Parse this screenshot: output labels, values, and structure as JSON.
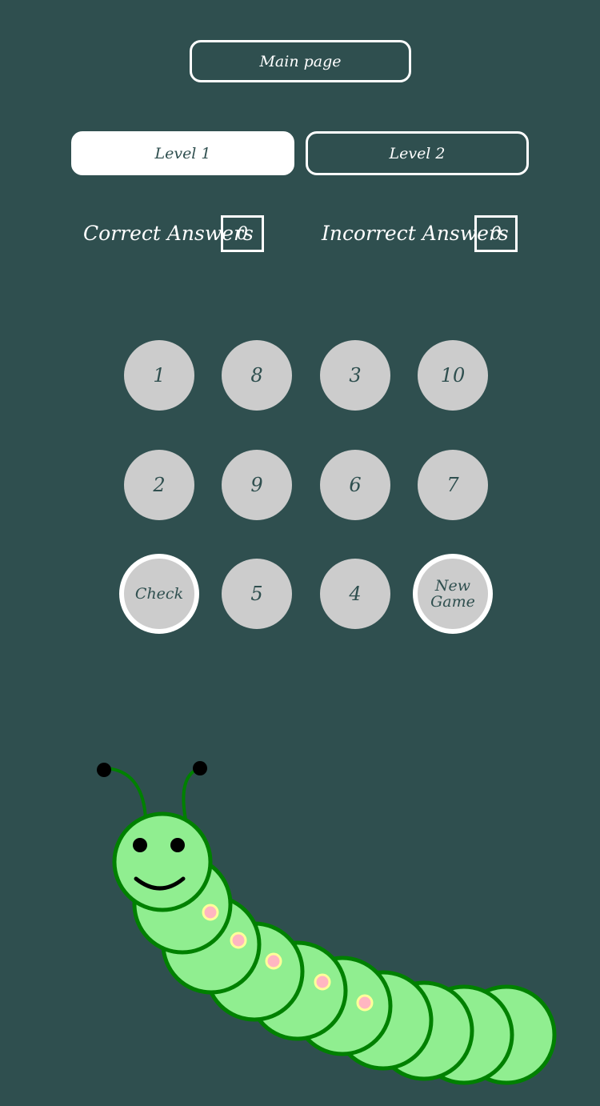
{
  "nav": {
    "main_page_label": "Main page"
  },
  "levels": [
    {
      "label": "Level 1",
      "active": true
    },
    {
      "label": "Level 2",
      "active": false
    }
  ],
  "score": {
    "correct_label": "Correct Answers",
    "correct_value": "0",
    "incorrect_label": "Incorrect Answers",
    "incorrect_value": "0"
  },
  "balls": [
    {
      "label": "1"
    },
    {
      "label": "8"
    },
    {
      "label": "3"
    },
    {
      "label": "10"
    },
    {
      "label": "2"
    },
    {
      "label": "9"
    },
    {
      "label": "6"
    },
    {
      "label": "7"
    },
    {
      "label": "5"
    },
    {
      "label": "4"
    }
  ],
  "actions": {
    "check_label": "Check",
    "new_game_label": "New Game"
  },
  "colors": {
    "background": "#2f4f4f",
    "ball": "#cccccc",
    "caterpillar_body": "#90ee90",
    "caterpillar_outline": "#008000",
    "spot": "#ffb6c1",
    "spot_ring": "#ffff99"
  }
}
